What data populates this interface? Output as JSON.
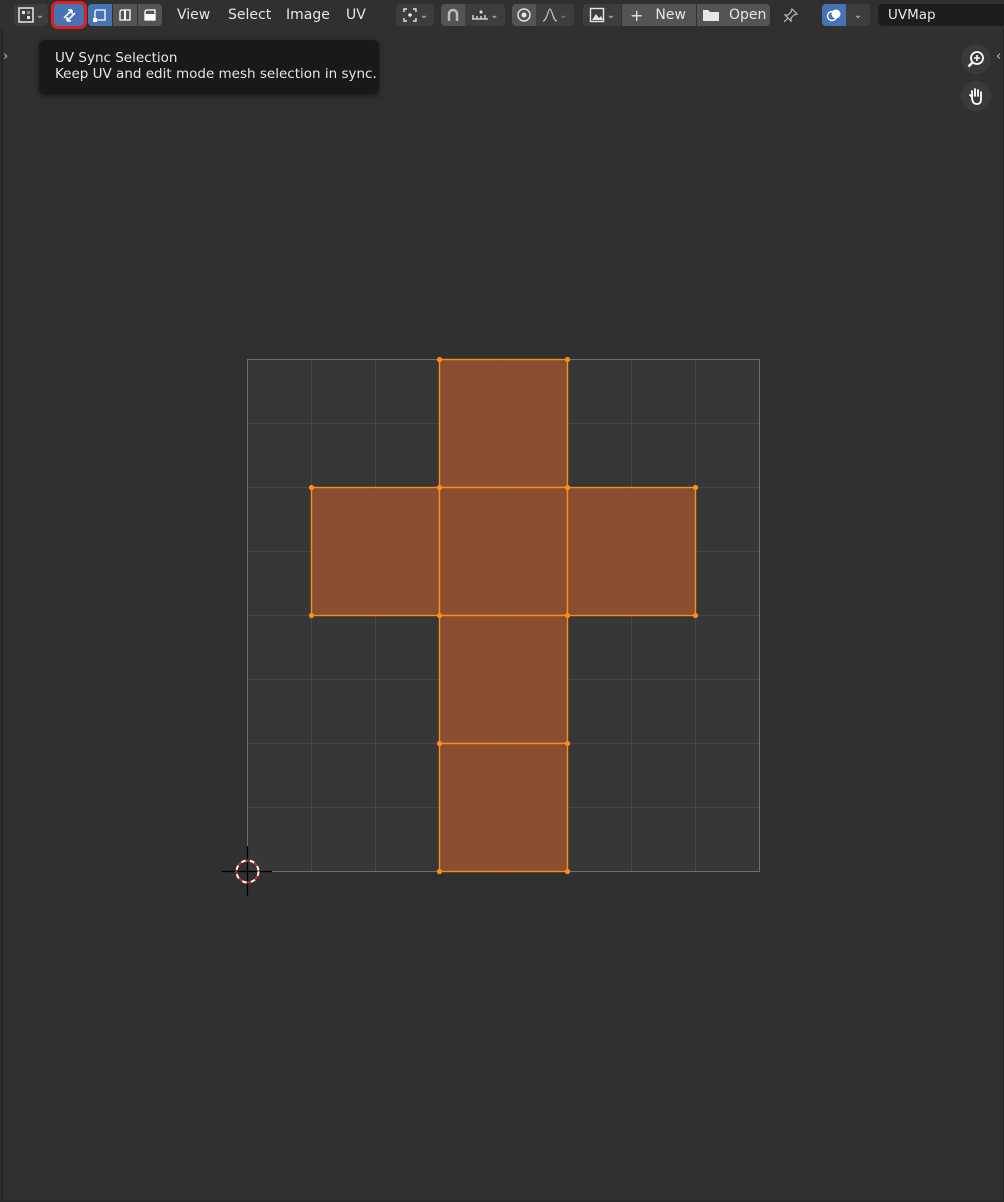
{
  "header": {
    "menus": [
      "View",
      "Select",
      "Image",
      "UV"
    ],
    "new_label": "New",
    "open_label": "Open",
    "uv_map_name": "UVMap"
  },
  "tooltip": {
    "title": "UV Sync Selection",
    "description": "Keep UV and edit mode mesh selection in sync."
  },
  "colors": {
    "face_fill": "#8b5030",
    "edge": "#ff8a1f",
    "grid_bg": "#3a3a3a",
    "active": "#4772b3",
    "highlight_box": "#e02020"
  }
}
